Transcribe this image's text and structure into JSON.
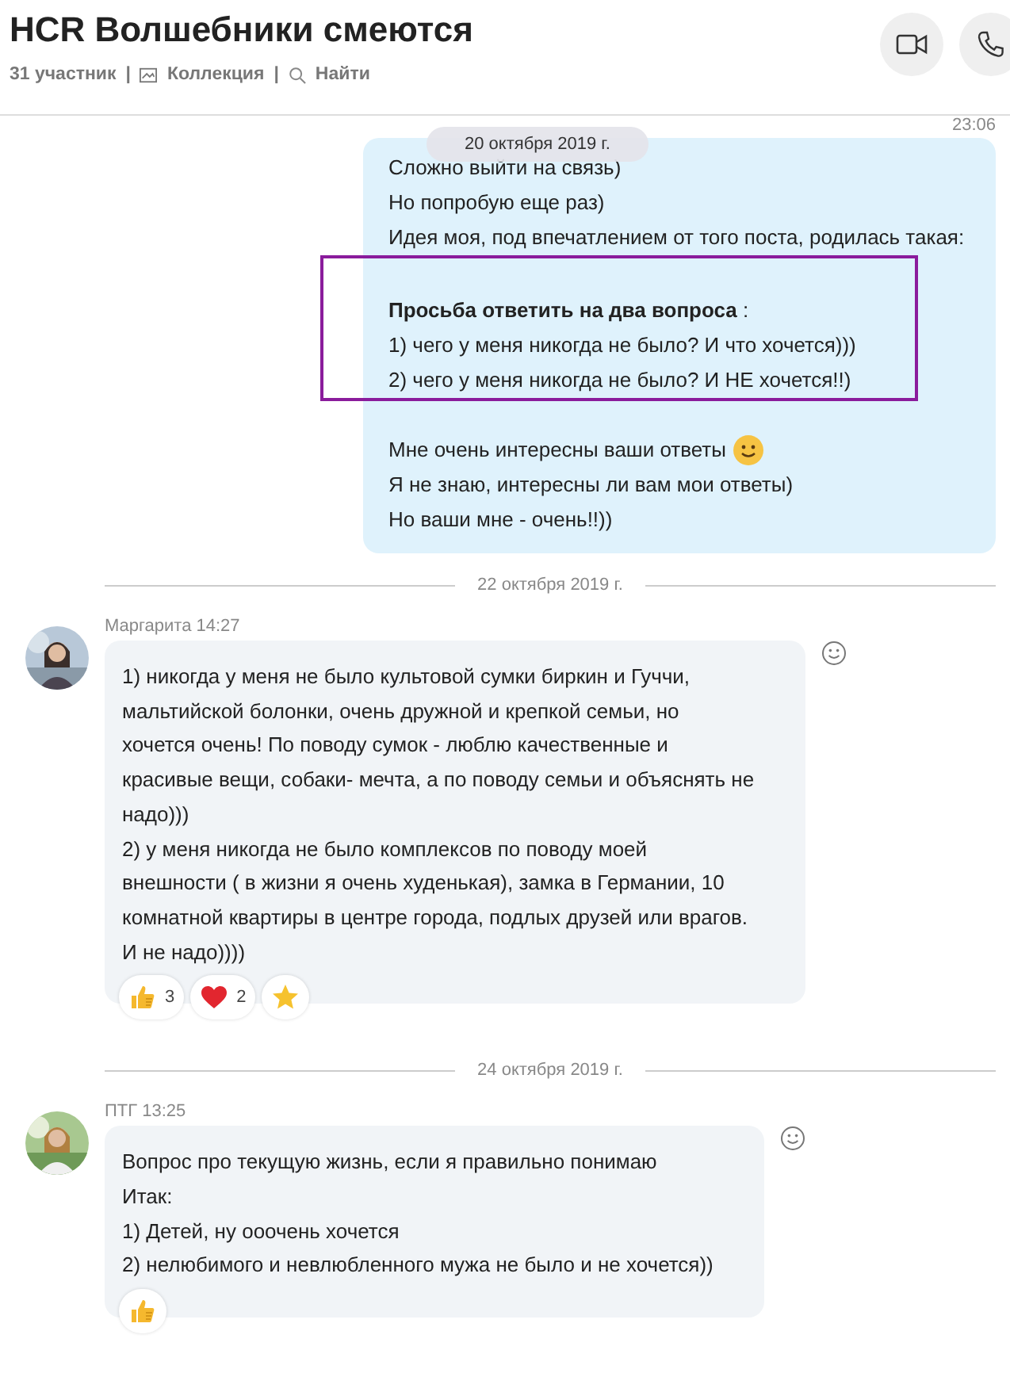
{
  "header": {
    "title": "HCR Волшебники смеются",
    "members": "31 участник",
    "separator_1": "|",
    "collection": "Коллекция",
    "separator_2": "|",
    "search": "Найти"
  },
  "messages": [
    {
      "kind": "outgoing",
      "time": "23:06",
      "date_pill": "20 октября 2019 г.",
      "blocks": [
        {
          "highlighted": false,
          "lines": [
            "Сложно выйти на связь)",
            "Но попробую еще раз)",
            "Идея моя, под впечатлением от того поста, родилась такая:"
          ]
        },
        {
          "highlighted": true,
          "lines": [
            "**Просьба ответить на два вопроса** :",
            "1) чего у меня никогда не было? И что хочется)))",
            "2) чего у меня никогда не было? И НЕ хочется!!)"
          ]
        },
        {
          "highlighted": false,
          "emoji": true,
          "lines": [
            "Мне очень интересны ваши ответы",
            "Я не знаю, интересны ли вам мои ответы)",
            "Но ваши мне - очень!!))"
          ]
        }
      ]
    },
    {
      "kind": "date",
      "text": "22 октября 2019 г."
    },
    {
      "kind": "incoming",
      "author": "Маргарита 14:27",
      "text": "1) никогда у меня не было культовой сумки биркин и Гуччи, мальтийской болонки, очень дружной и крепкой семьи, но хочется очень! По поводу сумок - люблю качественные и красивые вещи, собаки- мечта, а по поводу семьи и объяснять не надо)))\n2) у меня никогда не было комплексов по поводу моей внешности ( в жизни я очень худенькая), замка в Германии, 10 комнатной квартиры в центре города, подлых друзей или врагов. И не надо))))",
      "reactions": [
        {
          "kind": "like",
          "count": "3"
        },
        {
          "kind": "heart",
          "count": "2"
        },
        {
          "kind": "star"
        }
      ]
    },
    {
      "kind": "date",
      "text": "24 октября 2019 г."
    },
    {
      "kind": "incoming",
      "author": "ПТГ 13:25",
      "text": "Вопрос про текущую жизнь, если я правильно понимаю\nИтак:\n1) Детей, ну ооочень хочется\n2) нелюбимого и невлюбленного мужа не было и не хочется))",
      "reactions": [
        {
          "kind": "like"
        }
      ]
    }
  ]
}
